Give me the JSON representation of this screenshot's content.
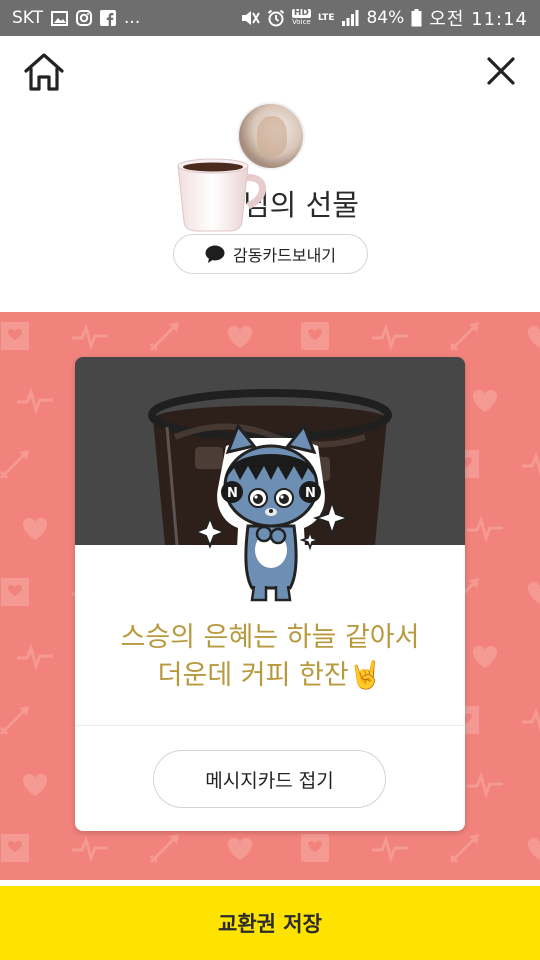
{
  "status_bar": {
    "carrier": "SKT",
    "left_icons": [
      "gallery-icon",
      "instagram-icon",
      "facebook-icon"
    ],
    "more": "...",
    "hd_label": "HD",
    "voice_label": "Voice",
    "lte_label": "LTE",
    "battery": "84%",
    "time": "오전 11:14"
  },
  "header": {
    "title": "님의 선물",
    "send_card_label": "감동카드보내기"
  },
  "card": {
    "message_line1": "스승의 은혜는 하늘 같아서",
    "message_line2": "더운데 커피 한잔🤘",
    "fold_label": "메시지카드 접기"
  },
  "footer": {
    "save_label": "교환권 저장"
  },
  "colors": {
    "pattern_bg": "#f2837c",
    "message_text": "#b89a3e",
    "save_bar": "#ffe300"
  }
}
